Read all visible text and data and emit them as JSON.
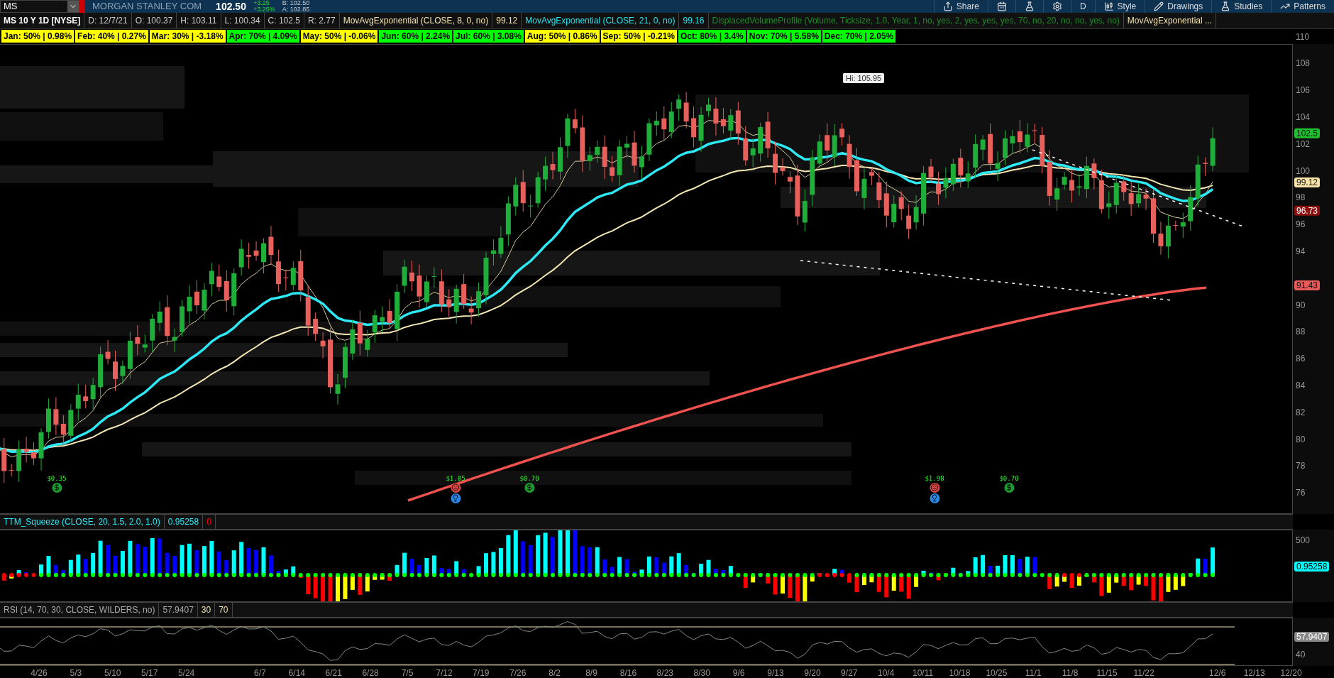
{
  "toolbar": {
    "symbol": "MS",
    "company": "MORGAN STANLEY COM",
    "last": "102.50",
    "change": "+3.25",
    "change_pct": "+3.25%",
    "bid": "B: 102.50",
    "ask": "A: 102.85",
    "buttons": [
      "Share",
      "D",
      "Style",
      "Drawings",
      "Studies",
      "Patterns"
    ]
  },
  "chart_header": {
    "title": "MS 10 Y 1D [NYSE]",
    "quote": [
      "D: 12/7/21",
      "O: 100.37",
      "H: 103.11",
      "L: 100.34",
      "C: 102.5",
      "R: 2.77"
    ],
    "studies": [
      {
        "label": "MovAvgExponential (CLOSE, 8, 0, no)",
        "value": "99.12",
        "color": "#f3e3b0"
      },
      {
        "label": "MovAvgExponential (CLOSE, 21, 0, no)",
        "value": "99.16",
        "color": "#22e6f0"
      },
      {
        "label": "DisplacedVolumeProfile (Volume, Ticksize, 1.0, Year, 1, no, yes, 2, yes, yes, yes, 70, no, 20, no, no, yes, no)",
        "color": "#1f8a2a"
      },
      {
        "label": "MovAvgExponential ...",
        "color": "#f3e3b0"
      }
    ]
  },
  "seasonality": [
    {
      "text": "Jan: 50% | 0.98%",
      "color": "#ffff00"
    },
    {
      "text": "Feb: 40% | 0.27%",
      "color": "#ffff00"
    },
    {
      "text": "Mar: 30% | -3.18%",
      "color": "#ffff00"
    },
    {
      "text": "Apr: 70% | 4.09%",
      "color": "#00ff00"
    },
    {
      "text": "May: 50% | -0.06%",
      "color": "#ffff00"
    },
    {
      "text": "Jun: 60% | 2.24%",
      "color": "#00ff00"
    },
    {
      "text": "Jul: 60% | 3.08%",
      "color": "#00ff00"
    },
    {
      "text": "Aug: 50% | 0.86%",
      "color": "#ffff00"
    },
    {
      "text": "Sep: 50% | -0.21%",
      "color": "#ffff00"
    },
    {
      "text": "Oct: 80% | 3.4%",
      "color": "#00ff00"
    },
    {
      "text": "Nov: 70% | 5.58%",
      "color": "#00ff00"
    },
    {
      "text": "Dec: 70% | 2.05%",
      "color": "#00ff00"
    }
  ],
  "price_chart": {
    "high_label": "Hi: 105.95",
    "axis_ticks": [
      "110",
      "108",
      "106",
      "104",
      "102",
      "100",
      "98",
      "96",
      "94",
      "90",
      "88",
      "86",
      "84",
      "82",
      "80",
      "78",
      "76"
    ],
    "price_badges": [
      {
        "text": "102.5",
        "color": "#1fbf2f"
      },
      {
        "text": "99.12",
        "color": "#f7e3a8"
      },
      {
        "text": "96.73",
        "color": "#8a0f0f"
      },
      {
        "text": "91.43",
        "color": "#e85a5a"
      }
    ],
    "events": [
      {
        "kind": "dividend",
        "text": "$0.35"
      },
      {
        "kind": "earnings",
        "text": "$1.85"
      },
      {
        "kind": "dividend",
        "text": "$0.70"
      },
      {
        "kind": "earnings",
        "text": "$1.98"
      },
      {
        "kind": "dividend",
        "text": "$0.70"
      }
    ]
  },
  "ttm_squeeze": {
    "label": "TTM_Squeeze (CLOSE, 20, 1.5, 2.0, 1.0)",
    "value": "0.95258",
    "alert": "0",
    "axis_tick": "500",
    "badge": "0.95258"
  },
  "rsi": {
    "label": "RSI (14, 70, 30, CLOSE, WILDERS, no)",
    "value": "57.9407",
    "oversold": "30",
    "overbought": "70",
    "axis_tick": "40",
    "badge": "57.9407"
  },
  "date_axis": [
    "4/26",
    "5/3",
    "5/10",
    "5/17",
    "5/24",
    "6/7",
    "6/14",
    "6/21",
    "6/28",
    "7/5",
    "7/12",
    "7/19",
    "7/26",
    "8/2",
    "8/9",
    "8/16",
    "8/23",
    "8/30",
    "9/6",
    "9/13",
    "9/20",
    "9/27",
    "10/4",
    "10/11",
    "10/18",
    "10/25",
    "11/1",
    "11/8",
    "11/15",
    "11/22",
    "12/6",
    "12/13",
    "12/20"
  ]
}
